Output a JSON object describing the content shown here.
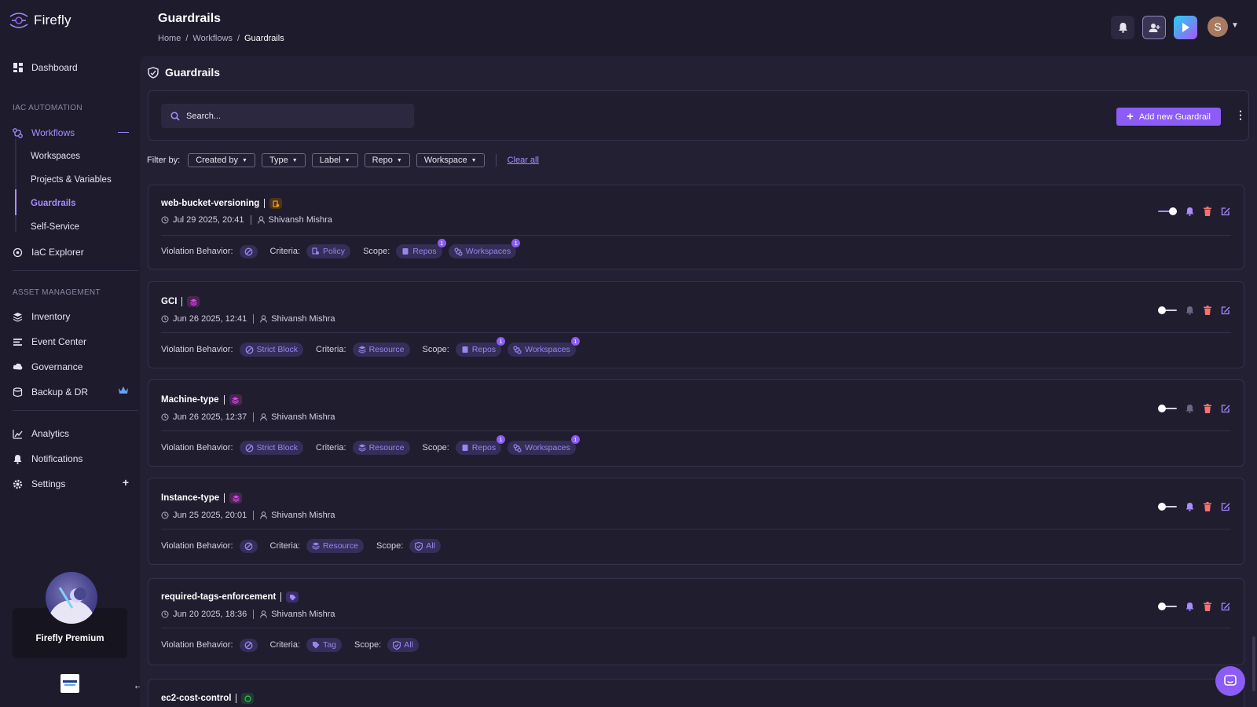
{
  "app": {
    "name": "Firefly"
  },
  "header": {
    "title": "Guardrails",
    "breadcrumb": [
      "Home",
      "Workflows",
      "Guardrails"
    ],
    "avatar_initial": "S"
  },
  "sidebar": {
    "dashboard": "Dashboard",
    "iac_section": "IAC AUTOMATION",
    "workflows": "Workflows",
    "sub": [
      "Workspaces",
      "Projects & Variables",
      "Guardrails",
      "Self-Service"
    ],
    "iac_explorer": "IaC Explorer",
    "asset_section": "ASSET MANAGEMENT",
    "inventory": "Inventory",
    "event_center": "Event Center",
    "governance": "Governance",
    "backup": "Backup & DR",
    "analytics": "Analytics",
    "notifications": "Notifications",
    "settings": "Settings",
    "premium": "Firefly Premium"
  },
  "main": {
    "title": "Guardrails",
    "search_placeholder": "Search...",
    "add_button": "Add new Guardrail",
    "filter_label": "Filter by:",
    "filters": [
      "Created by",
      "Type",
      "Label",
      "Repo",
      "Workspace"
    ],
    "clear_all": "Clear all"
  },
  "labels": {
    "violation": "Violation Behavior:",
    "criteria": "Criteria:",
    "scope": "Scope:"
  },
  "guardrails": [
    {
      "name": "web-bucket-versioning",
      "date": "Jul 29 2025, 20:41",
      "author": "Shivansh Mishra",
      "violation": "",
      "criteria": "Policy",
      "scope": [
        "Repos",
        "Workspaces"
      ],
      "scope_counts": [
        "1",
        "1"
      ],
      "enabled": true
    },
    {
      "name": "GCI",
      "date": "Jun 26 2025, 12:41",
      "author": "Shivansh Mishra",
      "violation": "Strict Block",
      "criteria": "Resource",
      "scope": [
        "Repos",
        "Workspaces"
      ],
      "scope_counts": [
        "1",
        "1"
      ],
      "enabled": false
    },
    {
      "name": "Machine-type",
      "date": "Jun 26 2025, 12:37",
      "author": "Shivansh Mishra",
      "violation": "Strict Block",
      "criteria": "Resource",
      "scope": [
        "Repos",
        "Workspaces"
      ],
      "scope_counts": [
        "1",
        "1"
      ],
      "enabled": false
    },
    {
      "name": "Instance-type",
      "date": "Jun 25 2025, 20:01",
      "author": "Shivansh Mishra",
      "violation": "",
      "criteria": "Resource",
      "scope": [
        "All"
      ],
      "enabled": false
    },
    {
      "name": "required-tags-enforcement",
      "date": "Jun 20 2025, 18:36",
      "author": "Shivansh Mishra",
      "violation": "",
      "criteria": "Tag",
      "scope": [
        "All"
      ],
      "enabled": false
    },
    {
      "name": "ec2-cost-control"
    }
  ],
  "colors": {
    "accent": "#8b5cf6",
    "accent_light": "#a98cff",
    "policy_badge": "#f59e0b",
    "resource_badge": "#d946ef",
    "tag_badge": "#8b5cf6",
    "cost_badge": "#22c55e",
    "delete": "#f87171",
    "play_button": "#22d3ee"
  }
}
